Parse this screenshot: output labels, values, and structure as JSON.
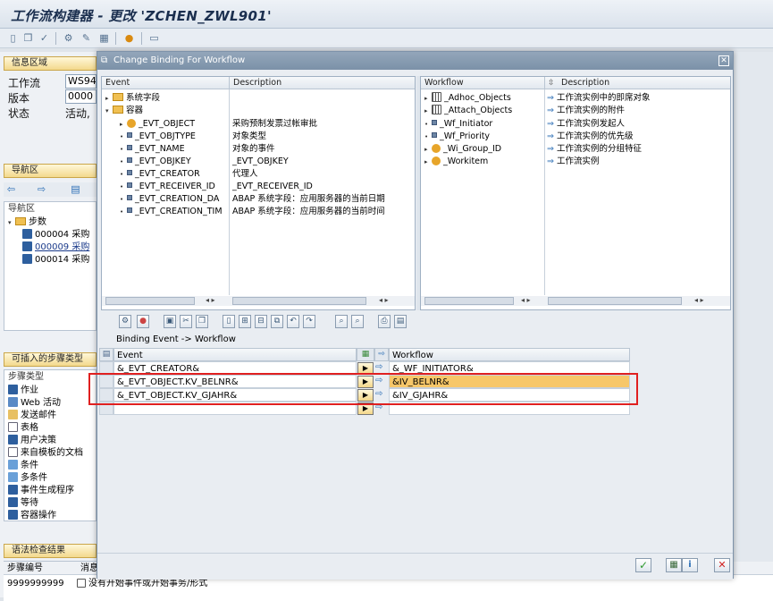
{
  "window_title": "工作流构建器 - 更改 'ZCHEN_ZWL901'",
  "info_area": {
    "header": "信息区域",
    "rows": [
      {
        "label": "工作流",
        "value": "WS94"
      },
      {
        "label": "版本",
        "value": "0000 ("
      },
      {
        "label": "状态",
        "value": "活动,"
      }
    ]
  },
  "nav_area": {
    "header": "导航区",
    "subheader": "导航区",
    "root": "步数",
    "items": [
      "000004 采购",
      "000009 采购",
      "000014 采购"
    ]
  },
  "insert_steps": {
    "header": "可插入的步骤类型",
    "subheader": "步骤类型",
    "items": [
      "作业",
      "Web 活动",
      "发送邮件",
      "表格",
      "用户决策",
      "来自模板的文档",
      "条件",
      "多条件",
      "事件生成程序",
      "等待",
      "容器操作"
    ]
  },
  "syntax": {
    "header": "语法检查结果",
    "col1": "步骤编号",
    "col2": "消息",
    "step": "9999999999",
    "message": "没有开始事件或开始事务/形式"
  },
  "dialog": {
    "title": "Change Binding For Workflow",
    "event_tree": {
      "col_event": "Event",
      "col_desc": "Description",
      "nodes": [
        {
          "name": "系统字段",
          "desc": ""
        },
        {
          "name": "容器",
          "desc": ""
        },
        {
          "name": "_EVT_OBJECT",
          "desc": "采购预制发票过帐审批"
        },
        {
          "name": "_EVT_OBJTYPE",
          "desc": "对象类型"
        },
        {
          "name": "_EVT_NAME",
          "desc": "对象的事件"
        },
        {
          "name": "_EVT_OBJKEY",
          "desc": "_EVT_OBJKEY"
        },
        {
          "name": "_EVT_CREATOR",
          "desc": "代理人"
        },
        {
          "name": "_EVT_RECEIVER_ID",
          "desc": "_EVT_RECEIVER_ID"
        },
        {
          "name": "_EVT_CREATION_DA",
          "desc": "ABAP 系统字段：应用服务器的当前日期"
        },
        {
          "name": "_EVT_CREATION_TIM",
          "desc": "ABAP 系统字段：应用服务器的当前时间"
        }
      ]
    },
    "workflow_tree": {
      "col_wf": "Workflow",
      "col_desc": "Description",
      "nodes": [
        {
          "name": "_Adhoc_Objects",
          "desc": "工作流实例中的即席对象"
        },
        {
          "name": "_Attach_Objects",
          "desc": "工作流实例的附件"
        },
        {
          "name": "_Wf_Initiator",
          "desc": "工作流实例发起人"
        },
        {
          "name": "_Wf_Priority",
          "desc": "工作流实例的优先级"
        },
        {
          "name": "_Wi_Group_ID",
          "desc": "工作流实例的分组特征"
        },
        {
          "name": "_Workitem",
          "desc": "工作流实例"
        }
      ]
    },
    "binding_label": "Binding Event  -> Workflow",
    "binding_table": {
      "col_event": "Event",
      "col_workflow": "Workflow",
      "rows": [
        {
          "event": "&_EVT_CREATOR&",
          "workflow": "&_WF_INITIATOR&"
        },
        {
          "event": "&_EVT_OBJECT.KV_BELNR&",
          "workflow": "&IV_BELNR&"
        },
        {
          "event": "&_EVT_OBJECT.KV_GJAHR&",
          "workflow": "&IV_GJAHR&"
        },
        {
          "event": "",
          "workflow": ""
        }
      ]
    }
  }
}
